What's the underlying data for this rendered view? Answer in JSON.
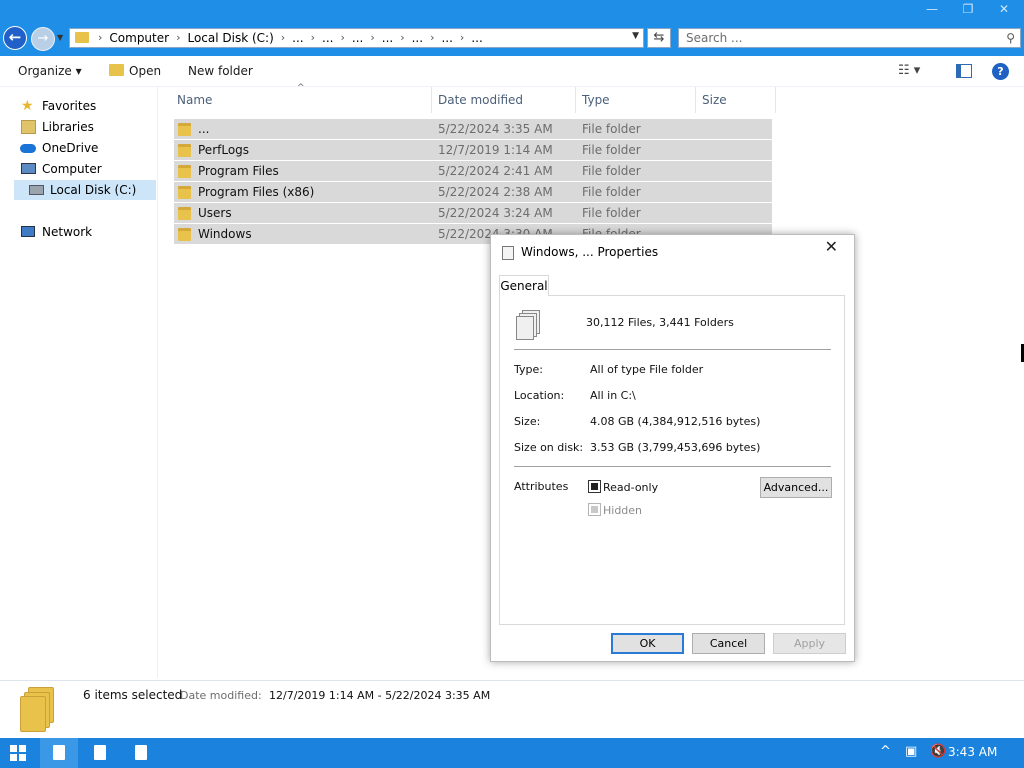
{
  "window": {
    "minimize": "—",
    "maximize": "❐",
    "close": "✕"
  },
  "nav_buttons": {
    "back": "←",
    "forward": "→"
  },
  "address": {
    "segments": [
      "Computer",
      "Local Disk (C:)",
      "...",
      "...",
      "...",
      "...",
      "...",
      "...",
      "..."
    ],
    "separator": "›"
  },
  "search": {
    "placeholder": "Search ..."
  },
  "toolbar": {
    "organize": "Organize ▾",
    "open": "Open",
    "new_folder": "New folder"
  },
  "nav_pane": {
    "items": [
      {
        "label": "Favorites",
        "icon": "star-icon"
      },
      {
        "label": "Libraries",
        "icon": "libraries-icon"
      },
      {
        "label": "OneDrive",
        "icon": "onedrive-cloud-icon"
      },
      {
        "label": "Computer",
        "icon": "computer-icon"
      },
      {
        "label": "Local Disk (C:)",
        "icon": "drive-icon",
        "selected": true
      },
      {
        "label": "Network",
        "icon": "network-icon"
      }
    ]
  },
  "columns": [
    "Name",
    "Date modified",
    "Type",
    "Size"
  ],
  "files": [
    {
      "name": "...",
      "date": "5/22/2024 3:35 AM",
      "type": "File folder"
    },
    {
      "name": "PerfLogs",
      "date": "12/7/2019 1:14 AM",
      "type": "File folder"
    },
    {
      "name": "Program Files",
      "date": "5/22/2024 2:41 AM",
      "type": "File folder"
    },
    {
      "name": "Program Files (x86)",
      "date": "5/22/2024 2:38 AM",
      "type": "File folder"
    },
    {
      "name": "Users",
      "date": "5/22/2024 3:24 AM",
      "type": "File folder"
    },
    {
      "name": "Windows",
      "date": "5/22/2024 3:30 AM",
      "type": "File folder"
    }
  ],
  "dialog": {
    "title": "Windows, ... Properties",
    "close": "✕",
    "tab": "General",
    "summary": "30,112 Files, 3,441 Folders",
    "type_label": "Type:",
    "type_value": "All of type File folder",
    "location_label": "Location:",
    "location_value": "All in C:\\",
    "size_label": "Size:",
    "size_value": "4.08 GB (4,384,912,516 bytes)",
    "size_on_disk_label": "Size on disk:",
    "size_on_disk_value": "3.53 GB (3,799,453,696 bytes)",
    "attributes_label": "Attributes",
    "readonly_label": "Read-only",
    "hidden_label": "Hidden",
    "advanced_button": "Advanced...",
    "ok_button": "OK",
    "cancel_button": "Cancel",
    "apply_button": "Apply"
  },
  "details": {
    "selected": "6 items selected",
    "date_label": "Date modified:",
    "date_range": "12/7/2019 1:14 AM - 5/22/2024 3:35 AM"
  },
  "taskbar": {
    "clock": "3:43 AM",
    "tray_chevron": "^"
  },
  "colors": {
    "titlebar": "#1e8ee6",
    "taskbar": "#1b83dd",
    "selection": "#d9d9d9",
    "nav_selected": "#cce5f8",
    "folder": "#e8c24a"
  }
}
